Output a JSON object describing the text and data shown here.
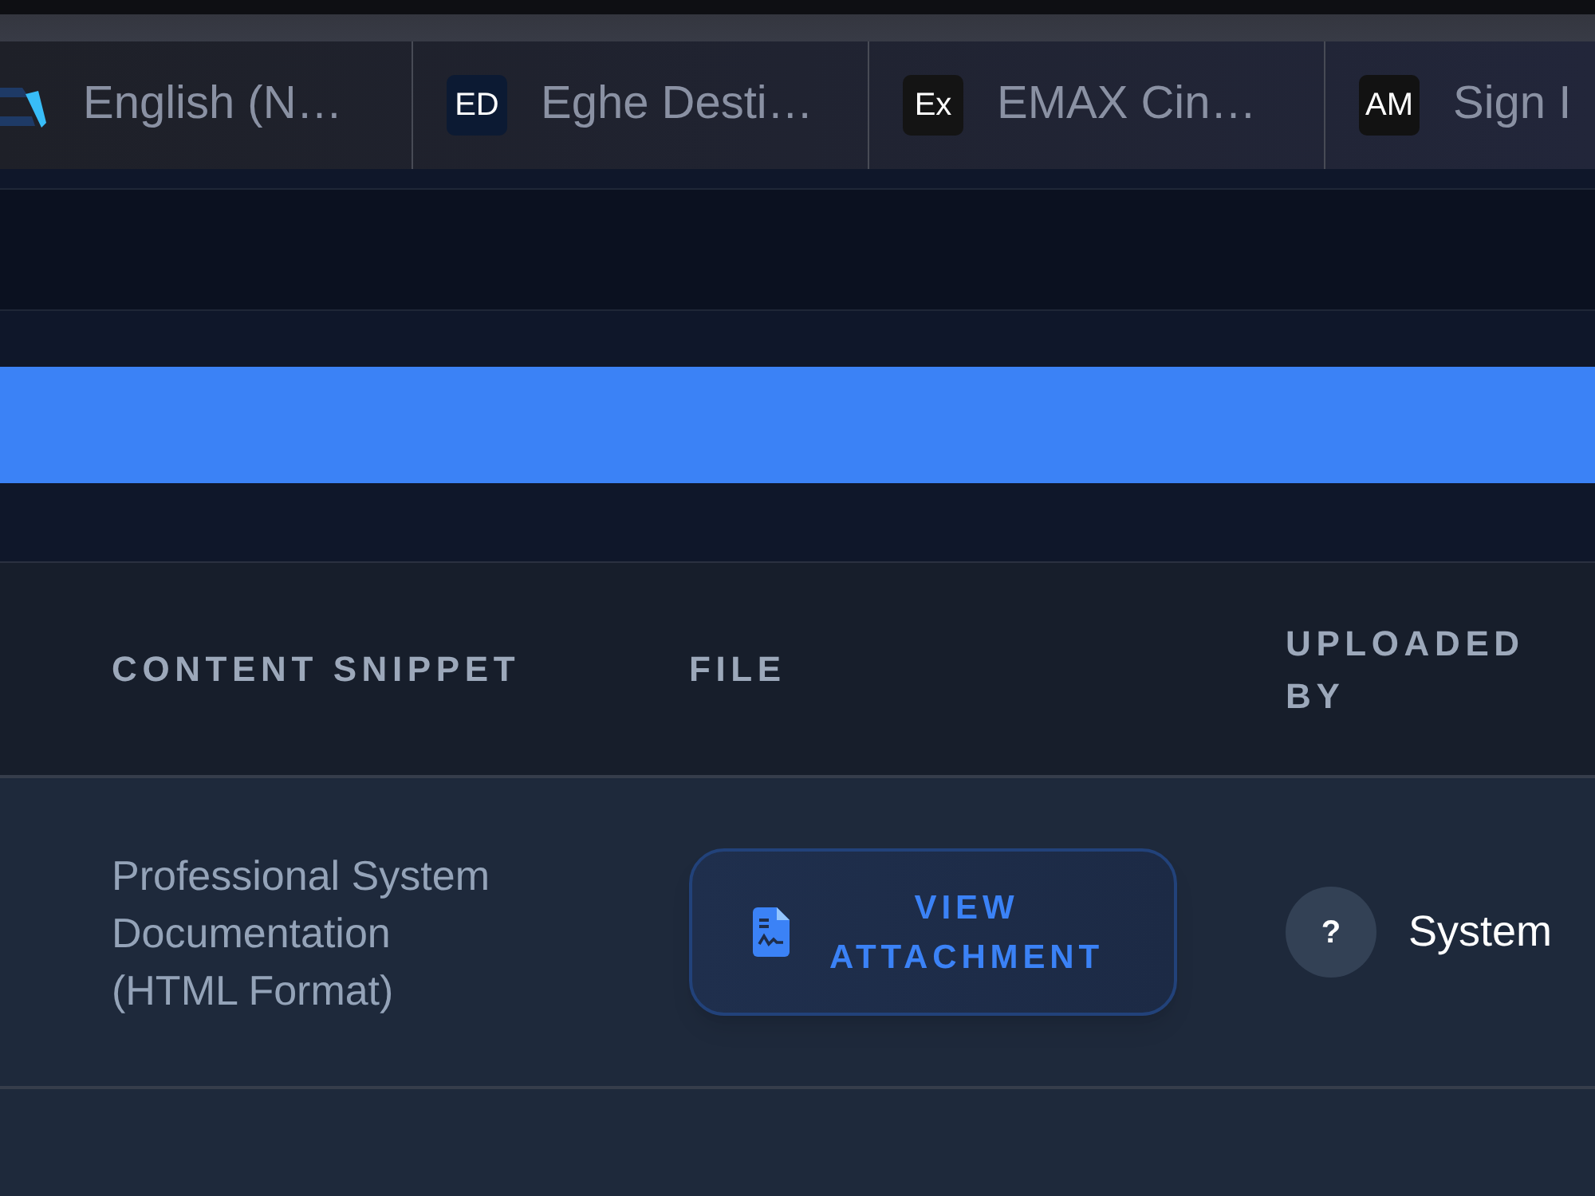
{
  "browser_tabs": [
    {
      "kind": "logo",
      "title": "English (N…"
    },
    {
      "kind": "badge",
      "badge": "ED",
      "color": "#0c1a33",
      "title": "Eghe Desti…"
    },
    {
      "kind": "badge",
      "badge": "Ex",
      "color": "#141414",
      "title": "EMAX Cin…"
    },
    {
      "kind": "badge",
      "badge": "AM",
      "color": "#121212",
      "title": "Sign I"
    }
  ],
  "table": {
    "columns": [
      "CONTENT SNIPPET",
      "FILE",
      "UPLOADED BY"
    ],
    "rows": [
      {
        "content_snippet": "Professional System Documentation (HTML Format)",
        "file": {
          "button": "VIEW ATTACHMENT"
        },
        "uploaded_by": {
          "avatar": "?",
          "name": "System"
        }
      }
    ]
  }
}
